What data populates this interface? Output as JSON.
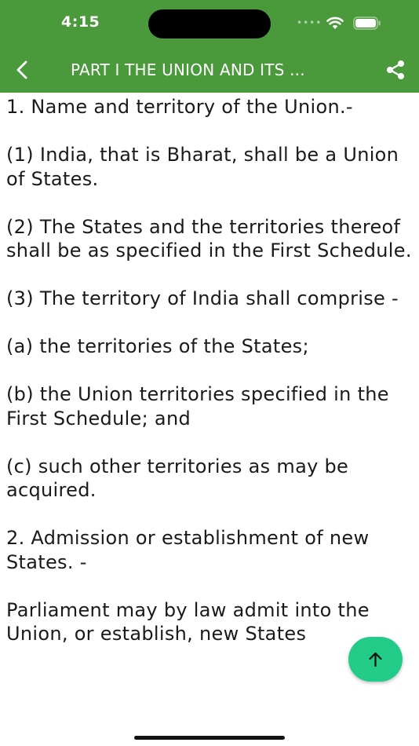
{
  "status_bar": {
    "time": "4:15",
    "signal": "••••"
  },
  "header": {
    "title": "PART I THE UNION AND ITS ..."
  },
  "content": {
    "paragraphs": [
      "1. Name and territory of the Union.-",
      "(1) India, that is Bharat, shall be a Union of States.",
      "(2) The States and the territories thereof shall be as specified in the First Schedule.",
      "(3) The territory of India shall comprise -",
      "(a) the territories of the States;",
      "(b) the Union territories specified in the First Schedule; and",
      "(c) such other territories as may be acquired.",
      "2. Admission or establishment of new States. -",
      "Parliament may by law admit into the Union, or establish, new States"
    ]
  },
  "colors": {
    "header_bg": "#4a9a3c",
    "fab_bg": "#22cc88",
    "text": "#1a1a1a"
  },
  "icons": {
    "back": "chevron-left-icon",
    "share": "share-icon",
    "fab": "arrow-up-icon"
  }
}
